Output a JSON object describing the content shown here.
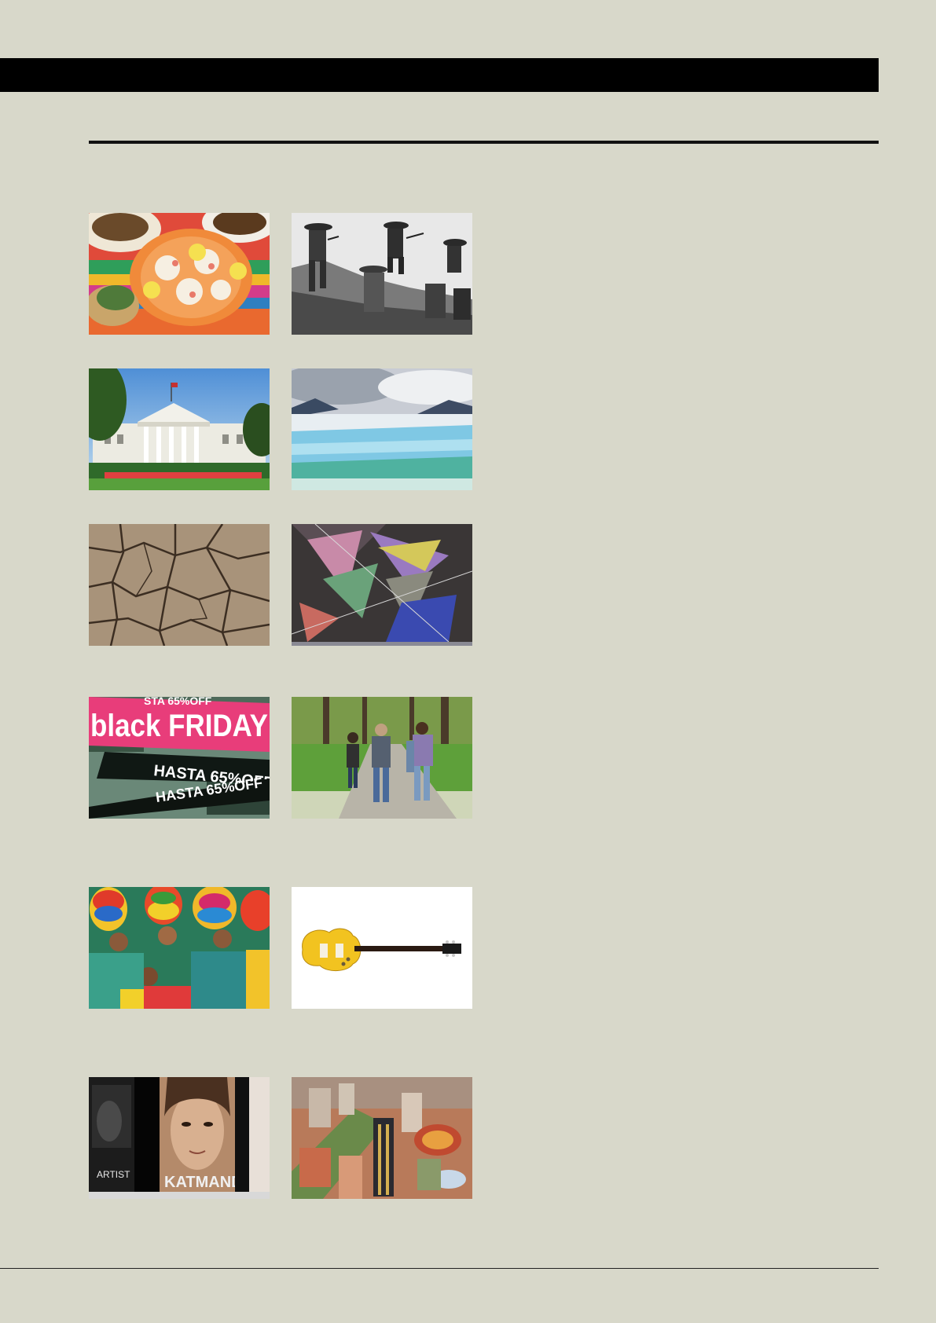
{
  "photos": {
    "black_friday": {
      "banner_text": "black FRIDAY",
      "sign_top": "STA 65%OFF",
      "sign_mid": "HASTA 65%OFF",
      "sign_bottom": "HASTA 65%OFF"
    },
    "posters": {
      "left_poster_title": "ARTIST",
      "right_poster_title": "KATMANDU"
    }
  }
}
